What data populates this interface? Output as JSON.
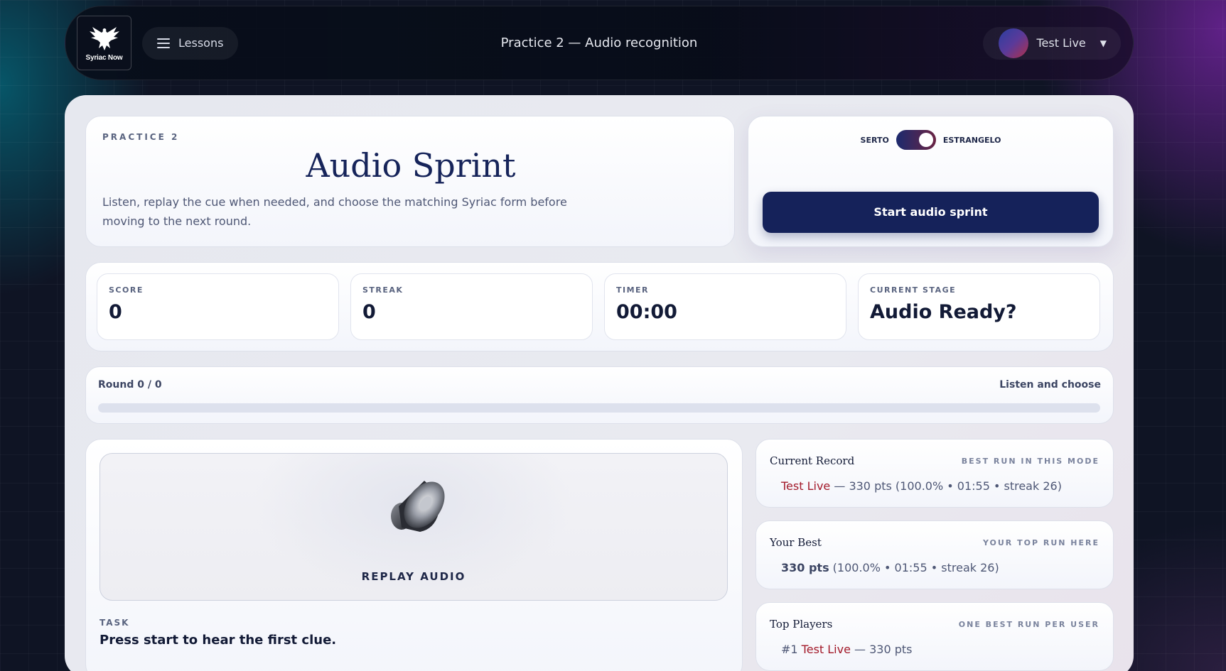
{
  "header": {
    "logo_text": "Syriac Now",
    "lessons_label": "Lessons",
    "title": "Practice 2 — Audio recognition",
    "user_name": "Test Live",
    "caret": "▼"
  },
  "hero": {
    "eyebrow": "PRACTICE 2",
    "title": "Audio Sprint",
    "description": "Listen, replay the cue when needed, and choose the matching Syriac form before moving to the next round."
  },
  "controls": {
    "toggle_left": "SERTO",
    "toggle_right": "ESTRANGELO",
    "start_label": "Start audio sprint"
  },
  "stats": [
    {
      "label": "SCORE",
      "value": "0"
    },
    {
      "label": "STREAK",
      "value": "0"
    },
    {
      "label": "TIMER",
      "value": "00:00"
    },
    {
      "label": "CURRENT STAGE",
      "value": "Audio Ready?"
    }
  ],
  "progress": {
    "round_label": "Round 0 / 0",
    "hint": "Listen and choose",
    "fraction": 0
  },
  "stage": {
    "replay_label": "REPLAY AUDIO",
    "task_label": "TASK",
    "task_text": "Press start to hear the first clue."
  },
  "leaderboard": {
    "current_record": {
      "title": "Current Record",
      "subtitle": "BEST RUN IN THIS MODE",
      "name": "Test Live",
      "detail": " — 330 pts (100.0% • 01:55 • streak 26)"
    },
    "your_best": {
      "title": "Your Best",
      "subtitle": "YOUR TOP RUN HERE",
      "points": "330 pts",
      "detail": " (100.0% • 01:55 • streak 26)"
    },
    "top_players": {
      "title": "Top Players",
      "subtitle": "ONE BEST RUN PER USER",
      "rank": "#1 ",
      "name": "Test Live",
      "detail": " — 330 pts"
    }
  },
  "colors": {
    "accent": "#15225a",
    "name_highlight": "#a31a2a"
  }
}
